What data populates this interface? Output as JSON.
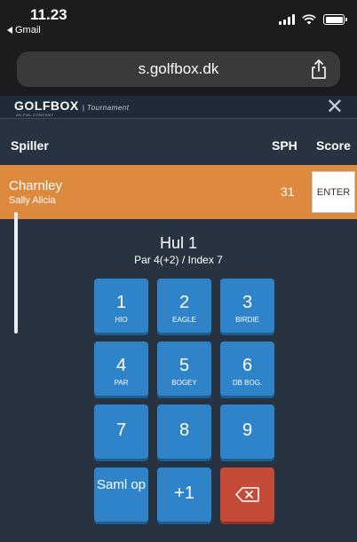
{
  "status_bar": {
    "time": "11.23",
    "back_app": "Gmail"
  },
  "browser": {
    "url": "s.golfbox.dk"
  },
  "app_header": {
    "logo": "GOLFBOX",
    "logo_suffix": "| Tournament",
    "logo_subtext": "AN FML COMPANY"
  },
  "table_header": {
    "player": "Spiller",
    "sph": "SPH",
    "score": "Score"
  },
  "player": {
    "last_name": "Charnley",
    "first_name": "Sally Alicia",
    "sph": "31",
    "enter_label": "ENTER"
  },
  "hole": {
    "title": "Hul 1",
    "info": "Par 4(+2) / Index 7"
  },
  "keypad": {
    "k1": {
      "num": "1",
      "label": "HIO"
    },
    "k2": {
      "num": "2",
      "label": "EAGLE"
    },
    "k3": {
      "num": "3",
      "label": "BIRDIE"
    },
    "k4": {
      "num": "4",
      "label": "PAR"
    },
    "k5": {
      "num": "5",
      "label": "BOGEY"
    },
    "k6": {
      "num": "6",
      "label": "DB BOG."
    },
    "k7": {
      "num": "7"
    },
    "k8": {
      "num": "8"
    },
    "k9": {
      "num": "9"
    },
    "pickup": {
      "num": "Saml op"
    },
    "plus1": {
      "num": "+1"
    }
  },
  "colors": {
    "background": "#273341",
    "player_row": "#dd8a3e",
    "key": "#2f83c8",
    "delete_key": "#c44b38"
  },
  "icons": [
    "share-icon",
    "close-icon",
    "backspace-icon",
    "signal-icon",
    "wifi-icon",
    "battery-icon"
  ]
}
